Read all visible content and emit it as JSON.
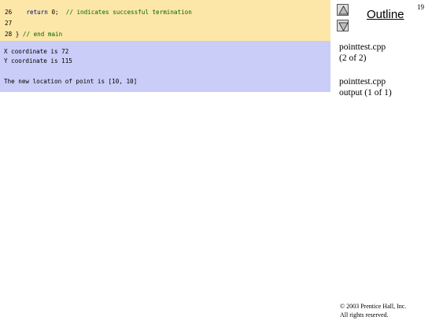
{
  "slide_number": "19",
  "code": {
    "lines": [
      {
        "num": "26",
        "indent": "    ",
        "keyword": "return",
        "rest": " 0;  ",
        "comment": "// indicates successful termination"
      },
      {
        "num": "27",
        "indent": "",
        "keyword": "",
        "rest": "",
        "comment": ""
      },
      {
        "num": "28",
        "indent": "",
        "keyword": "",
        "rest": " } ",
        "comment": "// end main"
      }
    ]
  },
  "output": {
    "lines": [
      "X coordinate is 72",
      "Y coordinate is 115",
      "",
      "The new location of point is [10, 10]"
    ]
  },
  "sidebar": {
    "title": "Outline",
    "up_icon": "up-arrow-icon",
    "down_icon": "down-arrow-icon",
    "file_label": "pointtest.cpp",
    "file_page": "(2 of 2)",
    "output_label_1": "pointtest.cpp",
    "output_label_2": "output (1 of 1)"
  },
  "footer": {
    "copyright_line1": "© 2003 Prentice Hall, Inc.",
    "copyright_line2": "All rights reserved."
  }
}
